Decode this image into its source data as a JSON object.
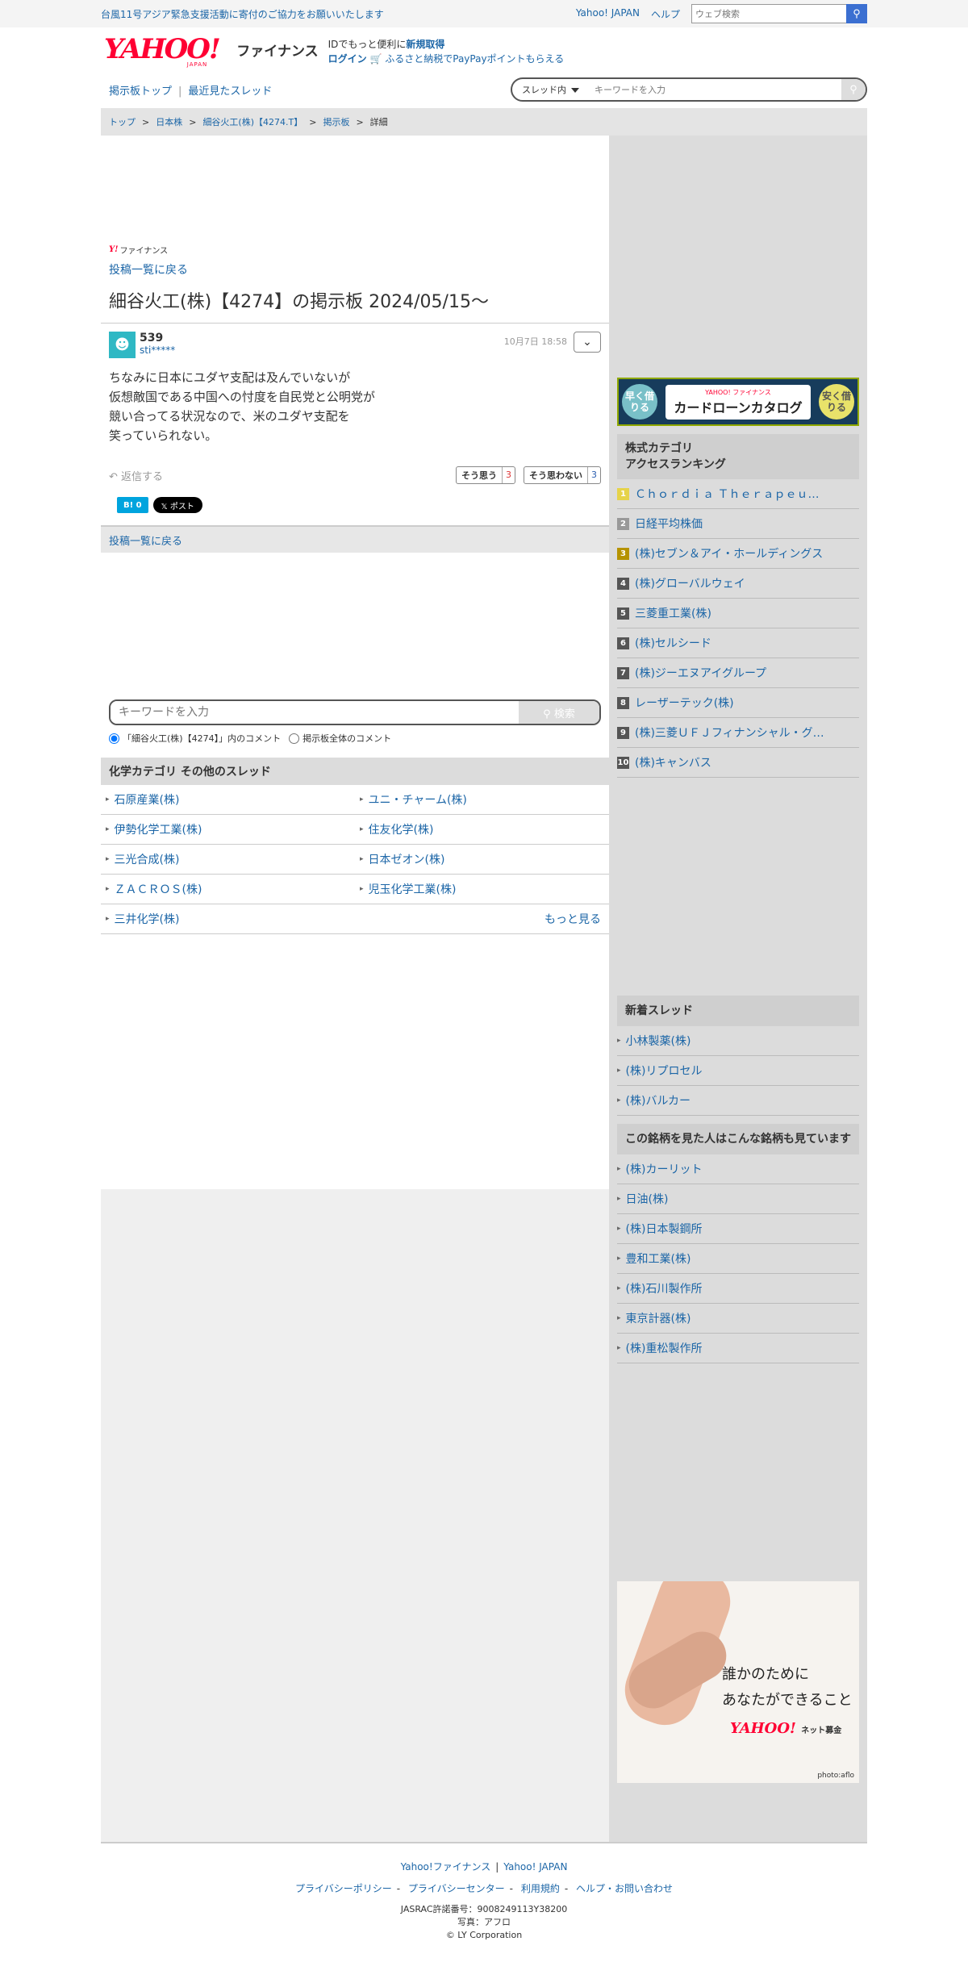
{
  "topbar": {
    "notice": "台風11号アジア緊急支援活動に寄付のご協力をお願いいたします",
    "links": [
      "Yahoo! JAPAN",
      "ヘルプ"
    ],
    "websearch_placeholder": "ウェブ検索"
  },
  "header": {
    "logo_text": "YAHOO!",
    "logo_sub": "JAPAN",
    "logo_service": "ファイナンス",
    "promo_line1_prefix": "IDでもっと便利に",
    "promo_line1_link": "新規取得",
    "login": "ログイン",
    "promo_line2": "ふるさと納税でPayPayポイントもらえる"
  },
  "subnav": {
    "board_top": "掲示板トップ",
    "separator": "|",
    "recent": "最近見たスレッド",
    "scope": "スレッド内",
    "search_placeholder": "キーワードを入力"
  },
  "breadcrumb": [
    "トップ",
    "日本株",
    "細谷火工(株)【4274.T】",
    "掲示板",
    "詳細"
  ],
  "main": {
    "mini_logo_y": "Y!",
    "mini_logo_text": "ファイナンス",
    "back_link": "投稿一覧に戻る",
    "title": "細谷火工(株)【4274】の掲示板 2024/05/15〜",
    "post": {
      "number": "539",
      "user": "sti*****",
      "date": "10月7日 18:58",
      "body": "ちなみに日本にユダヤ支配は及んでいないが\n仮想敵国である中国への忖度を自民党と公明党が\n競い合ってる状況なので、米のユダヤ支配を\n笑っていられない。",
      "reply": "返信する",
      "agree_label": "そう思う",
      "agree_count": "3",
      "disagree_label": "そう思わない",
      "disagree_count": "3",
      "hatena": "B! 0",
      "xpost": "𝕏 ポスト"
    },
    "back_bar": "投稿一覧に戻る",
    "keyword_placeholder": "キーワードを入力",
    "keyword_button": "検索",
    "radio_thread": "「細谷火工(株)【4274】」内のコメント",
    "radio_all": "掲示板全体のコメント",
    "category_header": "化学カテゴリ その他のスレッド",
    "category_items": [
      "石原産業(株)",
      "ユニ・チャーム(株)",
      "伊勢化学工業(株)",
      "住友化学(株)",
      "三光合成(株)",
      "日本ゼオン(株)",
      "ＺＡＣＲＯＳ(株)",
      "児玉化学工業(株)",
      "三井化学(株)"
    ],
    "more": "もっと見る"
  },
  "side": {
    "banner_left": "早く借りる",
    "banner_small": "YAHOO! ファイナンス",
    "banner_title": "カードローンカタログ",
    "banner_right": "安く借りる",
    "ranking_title_1": "株式カテゴリ",
    "ranking_title_2": "アクセスランキング",
    "ranking": [
      {
        "n": "1",
        "label": "Ｃｈｏｒｄｉａ Ｔｈｅｒａｐｅｕ…"
      },
      {
        "n": "2",
        "label": "日経平均株価"
      },
      {
        "n": "3",
        "label": "(株)セブン＆アイ・ホールディングス"
      },
      {
        "n": "4",
        "label": "(株)グローバルウェイ"
      },
      {
        "n": "5",
        "label": "三菱重工業(株)"
      },
      {
        "n": "6",
        "label": "(株)セルシード"
      },
      {
        "n": "7",
        "label": "(株)ジーエヌアイグループ"
      },
      {
        "n": "8",
        "label": "レーザーテック(株)"
      },
      {
        "n": "9",
        "label": "(株)三菱ＵＦＪフィナンシャル・グ…"
      },
      {
        "n": "10",
        "label": "(株)キャンバス"
      }
    ],
    "new_threads_title": "新着スレッド",
    "new_threads": [
      "小林製薬(株)",
      "(株)リプロセル",
      "(株)バルカー"
    ],
    "also_viewed_title": "この銘柄を見た人はこんな銘柄も見ています",
    "also_viewed": [
      "(株)カーリット",
      "日油(株)",
      "(株)日本製鋼所",
      "豊和工業(株)",
      "(株)石川製作所",
      "東京計器(株)",
      "(株)重松製作所"
    ],
    "promo_line1": "誰かのために",
    "promo_line2": "あなたができること",
    "promo_logo": "YAHOO!",
    "promo_logo_sub": "ネット募金",
    "promo_credit": "photo:aflo"
  },
  "footer": {
    "links1": [
      "Yahoo!ファイナンス",
      "Yahoo! JAPAN"
    ],
    "links2": [
      "プライバシーポリシー",
      "プライバシーセンター",
      "利用規約",
      "ヘルプ・お問い合わせ"
    ],
    "jasrac": "JASRAC許諾番号：9008249113Y38200",
    "photo": "写真：アフロ",
    "copyright": "© LY Corporation"
  }
}
